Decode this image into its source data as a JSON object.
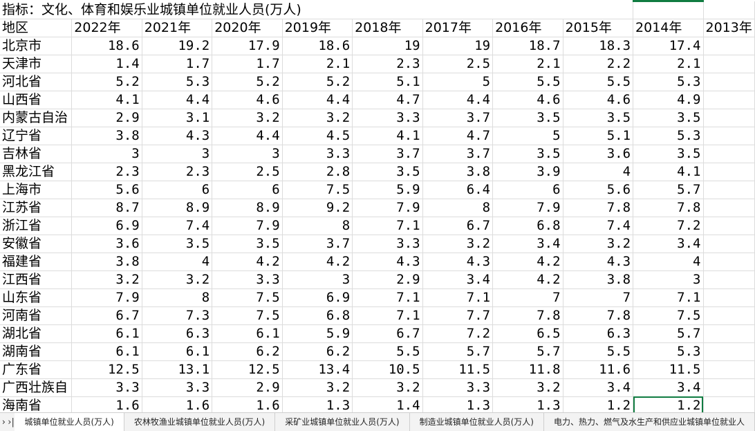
{
  "sheet": {
    "title": "指标：文化、体育和娱乐业城镇单位就业人员(万人)",
    "header": [
      "地区",
      "2022年",
      "2021年",
      "2020年",
      "2019年",
      "2018年",
      "2017年",
      "2016年",
      "2015年",
      "2014年",
      "2013年"
    ],
    "rows": [
      [
        "北京市",
        "18.6",
        "19.2",
        "17.9",
        "18.6",
        "19",
        "19",
        "18.7",
        "18.3",
        "17.4"
      ],
      [
        "天津市",
        "1.4",
        "1.7",
        "1.7",
        "2.1",
        "2.3",
        "2.5",
        "2.1",
        "2.2",
        "2.1"
      ],
      [
        "河北省",
        "5.2",
        "5.3",
        "5.2",
        "5.2",
        "5.1",
        "5",
        "5.5",
        "5.5",
        "5.3"
      ],
      [
        "山西省",
        "4.1",
        "4.4",
        "4.6",
        "4.4",
        "4.7",
        "4.4",
        "4.6",
        "4.6",
        "4.9"
      ],
      [
        "内蒙古自治",
        "2.9",
        "3.1",
        "3.2",
        "3.2",
        "3.3",
        "3.7",
        "3.5",
        "3.5",
        "3.5"
      ],
      [
        "辽宁省",
        "3.8",
        "4.3",
        "4.4",
        "4.5",
        "4.1",
        "4.7",
        "5",
        "5.1",
        "5.3"
      ],
      [
        "吉林省",
        "3",
        "3",
        "3",
        "3.3",
        "3.7",
        "3.7",
        "3.5",
        "3.6",
        "3.5"
      ],
      [
        "黑龙江省",
        "2.3",
        "2.3",
        "2.5",
        "2.8",
        "3.5",
        "3.8",
        "3.9",
        "4",
        "4.1"
      ],
      [
        "上海市",
        "5.6",
        "6",
        "6",
        "7.5",
        "5.9",
        "6.4",
        "6",
        "5.6",
        "5.7"
      ],
      [
        "江苏省",
        "8.7",
        "8.9",
        "8.9",
        "9.2",
        "7.9",
        "8",
        "7.9",
        "7.8",
        "7.8"
      ],
      [
        "浙江省",
        "6.9",
        "7.4",
        "7.9",
        "8",
        "7.1",
        "6.7",
        "6.8",
        "7.4",
        "7.2"
      ],
      [
        "安徽省",
        "3.6",
        "3.5",
        "3.5",
        "3.7",
        "3.3",
        "3.2",
        "3.4",
        "3.2",
        "3.4"
      ],
      [
        "福建省",
        "3.8",
        "4",
        "4.2",
        "4.2",
        "4.3",
        "4.3",
        "4.2",
        "4.3",
        "4"
      ],
      [
        "江西省",
        "3.2",
        "3.2",
        "3.3",
        "3",
        "2.9",
        "3.4",
        "4.2",
        "3.8",
        "3"
      ],
      [
        "山东省",
        "7.9",
        "8",
        "7.5",
        "6.9",
        "7.1",
        "7.1",
        "7",
        "7",
        "7.1"
      ],
      [
        "河南省",
        "6.7",
        "7.3",
        "7.5",
        "6.8",
        "7.1",
        "7.7",
        "7.8",
        "7.8",
        "7.5"
      ],
      [
        "湖北省",
        "6.1",
        "6.3",
        "6.1",
        "5.9",
        "6.7",
        "7.2",
        "6.5",
        "6.3",
        "5.7"
      ],
      [
        "湖南省",
        "6.1",
        "6.1",
        "6.2",
        "6.2",
        "5.5",
        "5.7",
        "5.7",
        "5.5",
        "5.3"
      ],
      [
        "广东省",
        "12.5",
        "13.1",
        "12.5",
        "13.4",
        "10.5",
        "11.5",
        "11.8",
        "11.6",
        "11.5"
      ],
      [
        "广西壮族自",
        "3.3",
        "3.3",
        "2.9",
        "3.2",
        "3.2",
        "3.3",
        "3.2",
        "3.4",
        "3.4"
      ],
      [
        "海南省",
        "1.6",
        "1.6",
        "1.6",
        "1.3",
        "1.4",
        "1.3",
        "1.3",
        "1.2",
        "1.2"
      ]
    ]
  },
  "tabs": {
    "nav_next": "›",
    "nav_last": "›|",
    "items": [
      "城镇单位就业人员(万人)",
      "农林牧渔业城镇单位就业人员(万人)",
      "采矿业城镇单位就业人员(万人)",
      "制造业城镇单位就业人员(万人)",
      "电力、热力、燃气及水生产和供应业城镇单位就业人"
    ]
  },
  "colors": {
    "selection": "#107c41",
    "gridline": "#dcdcdc",
    "tabbar": "#f3f3f3"
  }
}
